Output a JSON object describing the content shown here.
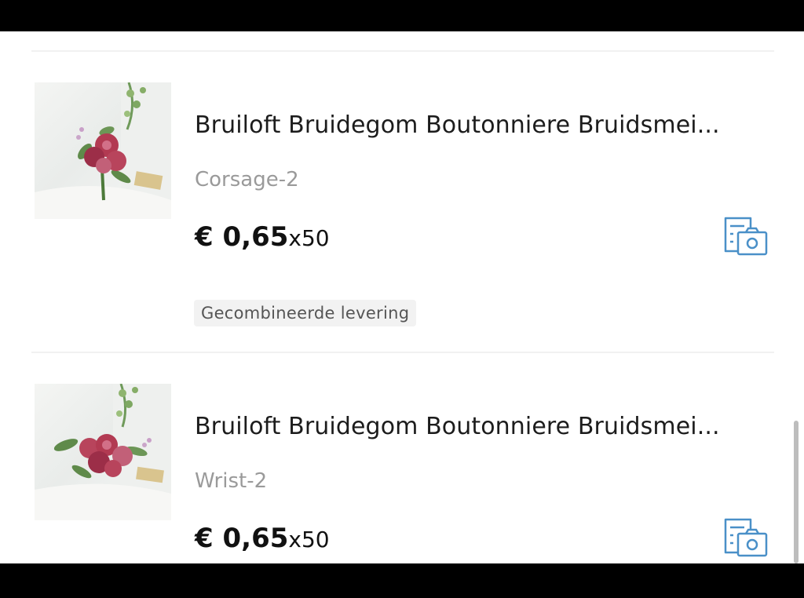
{
  "orders": [
    {
      "title": "Bruiloft Bruidegom Boutonniere Bruidsmei...",
      "variant": "Corsage-2",
      "price": "€ 0,65",
      "quantity": "x50",
      "tag": "Gecombineerde levering",
      "review_icon": "photo-review-icon"
    },
    {
      "title": "Bruiloft Bruidegom Boutonniere Bruidsmei...",
      "variant": "Wrist-2",
      "price": "€ 0,65",
      "quantity": "x50",
      "review_icon": "photo-review-icon"
    }
  ],
  "colors": {
    "accent_icon": "#4a90c8",
    "rose": "#b23a52",
    "leaf": "#5f8a4a"
  }
}
